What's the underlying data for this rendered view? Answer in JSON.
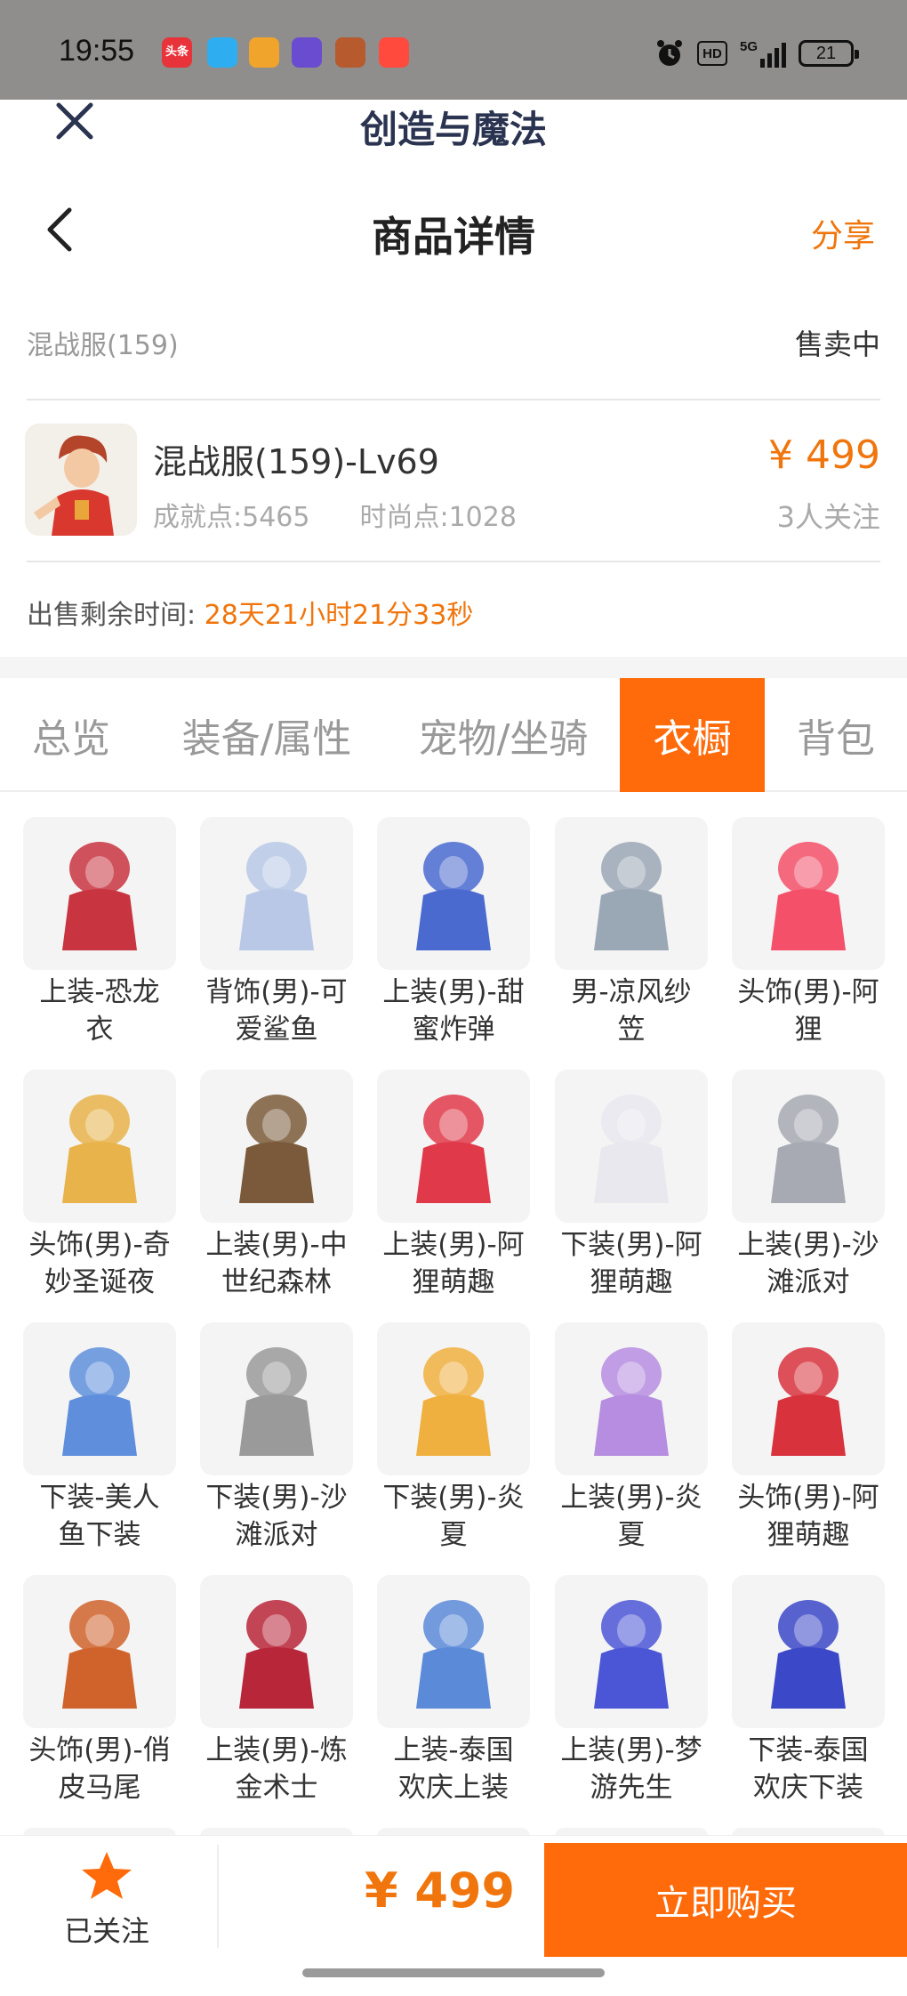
{
  "status_bar": {
    "time": "19:55",
    "hd_label": "HD",
    "signal_label": "5G",
    "battery": "21",
    "notification_icons": [
      {
        "name": "toutiao-icon",
        "color": "#e8333a",
        "label": "头条"
      },
      {
        "name": "qq-icon",
        "color": "#2eaef0",
        "label": ""
      },
      {
        "name": "game-icon-1",
        "color": "#f1a42c",
        "label": ""
      },
      {
        "name": "browser-icon",
        "color": "#6a4cd1",
        "label": ""
      },
      {
        "name": "game-icon-2",
        "color": "#b75b2e",
        "label": ""
      },
      {
        "name": "kuaishou-icon",
        "color": "#ff4a3d",
        "label": ""
      }
    ]
  },
  "app": {
    "title": "创造与魔法"
  },
  "nav": {
    "title": "商品详情",
    "share": "分享"
  },
  "server": {
    "name": "混战服(159)",
    "status": "售卖中"
  },
  "product": {
    "name": "混战服(159)-Lv69",
    "achievement": "成就点:5465",
    "fashion": "时尚点:1028",
    "price": "¥ 499",
    "followers": "3人关注"
  },
  "remaining": {
    "label": "出售剩余时间:",
    "value": "28天21小时21分33秒"
  },
  "tabs": [
    {
      "label": "总览",
      "active": false
    },
    {
      "label": "装备/属性",
      "active": false
    },
    {
      "label": "宠物/坐骑",
      "active": false
    },
    {
      "label": "衣橱",
      "active": true
    },
    {
      "label": "背包",
      "active": false
    }
  ],
  "wardrobe": [
    {
      "line1": "上装-恐龙",
      "line2": "衣",
      "color": "#c8343f"
    },
    {
      "line1": "背饰(男)-可",
      "line2": "爱鲨鱼",
      "color": "#b9c8e6"
    },
    {
      "line1": "上装(男)-甜",
      "line2": "蜜炸弹",
      "color": "#4a6ad0"
    },
    {
      "line1": "男-凉风纱",
      "line2": "笠",
      "color": "#9aa7b5"
    },
    {
      "line1": "头饰(男)-阿",
      "line2": "狸",
      "color": "#f4506a"
    },
    {
      "line1": "头饰(男)-奇",
      "line2": "妙圣诞夜",
      "color": "#e8b34a"
    },
    {
      "line1": "上装(男)-中",
      "line2": "世纪森林",
      "color": "#7a5a3a"
    },
    {
      "line1": "上装(男)-阿",
      "line2": "狸萌趣",
      "color": "#e03a4a"
    },
    {
      "line1": "下装(男)-阿",
      "line2": "狸萌趣",
      "color": "#e8e8ee"
    },
    {
      "line1": "上装(男)-沙",
      "line2": "滩派对",
      "color": "#a7a9b3"
    },
    {
      "line1": "下装-美人",
      "line2": "鱼下装",
      "color": "#5f8fdc"
    },
    {
      "line1": "下装(男)-沙",
      "line2": "滩派对",
      "color": "#9a9a9a"
    },
    {
      "line1": "下装(男)-炎",
      "line2": "夏",
      "color": "#f0b040"
    },
    {
      "line1": "上装(男)-炎",
      "line2": "夏",
      "color": "#b68de0"
    },
    {
      "line1": "头饰(男)-阿",
      "line2": "狸萌趣",
      "color": "#d8323d"
    },
    {
      "line1": "头饰(男)-俏",
      "line2": "皮马尾",
      "color": "#d0632c"
    },
    {
      "line1": "上装(男)-炼",
      "line2": "金术士",
      "color": "#b8263a"
    },
    {
      "line1": "上装-泰国",
      "line2": "欢庆上装",
      "color": "#5a8ad8"
    },
    {
      "line1": "上装(男)-梦",
      "line2": "游先生",
      "color": "#4b56d6"
    },
    {
      "line1": "下装-泰国",
      "line2": "欢庆下装",
      "color": "#3b48c8"
    }
  ],
  "bottom": {
    "follow_label": "已关注",
    "price": "¥ 499",
    "buy_label": "立即购买"
  },
  "colors": {
    "accent": "#ff6a0a",
    "price": "#f0750d"
  }
}
